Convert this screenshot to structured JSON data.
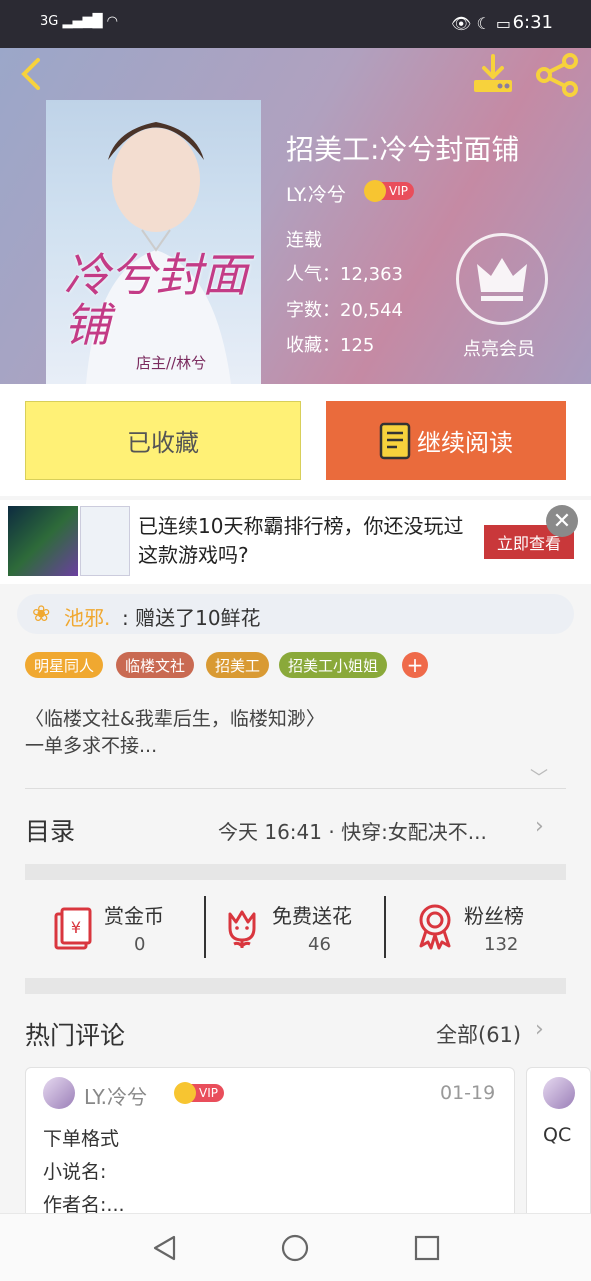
{
  "status_bar": {
    "signal": "3G",
    "time": "6:31"
  },
  "book": {
    "title": "招美工:冷兮封面铺",
    "author": "LY.冷兮",
    "vip_badge": "VIP",
    "status": "连载",
    "popularity": "人气：12,363",
    "word_count": "字数：20,544",
    "favorites": "收藏：125",
    "member_label": "点亮会员",
    "cover_title_art": "冷兮封面铺",
    "cover_subtitle_art": "店主//林兮"
  },
  "actions": {
    "saved_label": "已收藏",
    "read_label": "继续阅读"
  },
  "ad": {
    "text": "已连续10天称霸排行榜，你还没玩过这款游戏吗?",
    "cta": "立即查看"
  },
  "gift": {
    "user": "池邪.",
    "text": ": 赠送了10鲜花"
  },
  "tags": [
    {
      "label": "明星同人",
      "color": "#f0a830"
    },
    {
      "label": "临楼文社",
      "color": "#c96a52"
    },
    {
      "label": "招美工",
      "color": "#d99a33"
    },
    {
      "label": "招美工小姐姐",
      "color": "#8aa93a"
    }
  ],
  "description": {
    "line1": "〈临楼文社&我辈后生，临楼知渺〉",
    "line2": "一单多求不接..."
  },
  "toc": {
    "label": "目录",
    "latest": "今天 16:41 · 快穿:女配决不..."
  },
  "stats": [
    {
      "label": "赏金币",
      "value": "0"
    },
    {
      "label": "免费送花",
      "value": "46"
    },
    {
      "label": "粉丝榜",
      "value": "132"
    }
  ],
  "comments": {
    "label": "热门评论",
    "all_label": "全部(61)",
    "first": {
      "user": "LY.冷兮",
      "vip": "VIP",
      "date": "01-19",
      "lines": [
        "下单格式",
        "小说名:",
        "作者名:..."
      ]
    },
    "second_peek": "QC"
  }
}
